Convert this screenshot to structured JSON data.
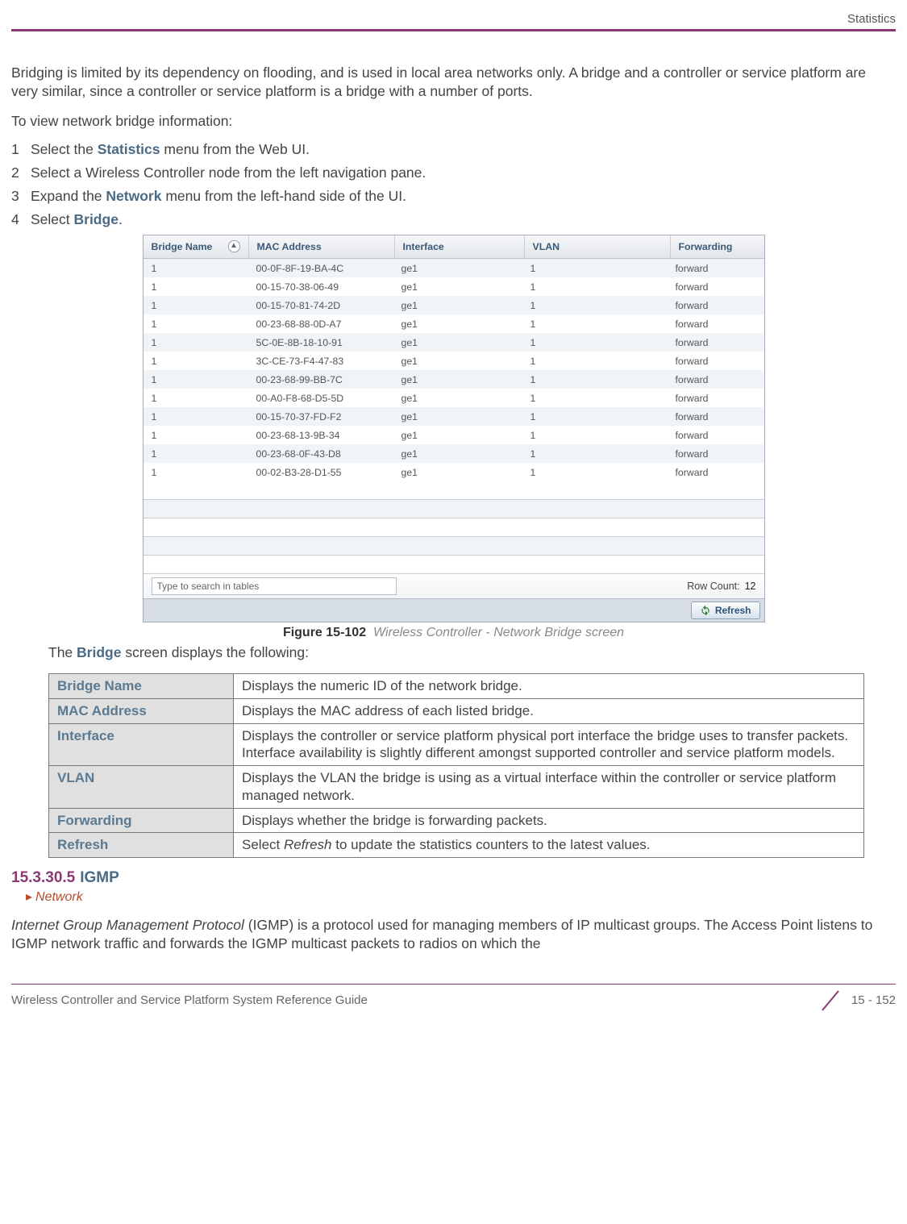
{
  "header": {
    "section": "Statistics"
  },
  "intro": {
    "p1": "Bridging is limited by its dependency on flooding, and is used in local area networks only. A bridge and a controller or service platform are very similar, since a controller or service platform is a bridge with a number of ports.",
    "p2": "To view network bridge information:"
  },
  "steps": [
    {
      "n": "1",
      "pre": "Select the ",
      "bold": "Statistics",
      "post": " menu from the Web UI."
    },
    {
      "n": "2",
      "pre": "Select a Wireless Controller node from the left navigation pane.",
      "bold": "",
      "post": ""
    },
    {
      "n": "3",
      "pre": "Expand the ",
      "bold": "Network",
      "post": " menu from the left-hand side of the UI."
    },
    {
      "n": "4",
      "pre": "Select ",
      "bold": "Bridge",
      "post": "."
    }
  ],
  "screenshot": {
    "headers": {
      "bridge": "Bridge Name",
      "mac": "MAC Address",
      "intf": "Interface",
      "vlan": "VLAN",
      "fwd": "Forwarding"
    },
    "rows": [
      {
        "b": "1",
        "m": "00-0F-8F-19-BA-4C",
        "i": "ge1",
        "v": "1",
        "f": "forward"
      },
      {
        "b": "1",
        "m": "00-15-70-38-06-49",
        "i": "ge1",
        "v": "1",
        "f": "forward"
      },
      {
        "b": "1",
        "m": "00-15-70-81-74-2D",
        "i": "ge1",
        "v": "1",
        "f": "forward"
      },
      {
        "b": "1",
        "m": "00-23-68-88-0D-A7",
        "i": "ge1",
        "v": "1",
        "f": "forward"
      },
      {
        "b": "1",
        "m": "5C-0E-8B-18-10-91",
        "i": "ge1",
        "v": "1",
        "f": "forward"
      },
      {
        "b": "1",
        "m": "3C-CE-73-F4-47-83",
        "i": "ge1",
        "v": "1",
        "f": "forward"
      },
      {
        "b": "1",
        "m": "00-23-68-99-BB-7C",
        "i": "ge1",
        "v": "1",
        "f": "forward"
      },
      {
        "b": "1",
        "m": "00-A0-F8-68-D5-5D",
        "i": "ge1",
        "v": "1",
        "f": "forward"
      },
      {
        "b": "1",
        "m": "00-15-70-37-FD-F2",
        "i": "ge1",
        "v": "1",
        "f": "forward"
      },
      {
        "b": "1",
        "m": "00-23-68-13-9B-34",
        "i": "ge1",
        "v": "1",
        "f": "forward"
      },
      {
        "b": "1",
        "m": "00-23-68-0F-43-D8",
        "i": "ge1",
        "v": "1",
        "f": "forward"
      },
      {
        "b": "1",
        "m": "00-02-B3-28-D1-55",
        "i": "ge1",
        "v": "1",
        "f": "forward"
      }
    ],
    "search_placeholder": "Type to search in tables",
    "rowcount_label": "Row Count:",
    "rowcount_value": "12",
    "refresh": "Refresh"
  },
  "figure": {
    "num": "Figure 15-102",
    "title": "Wireless Controller - Network Bridge screen"
  },
  "desc_intro_pre": "The ",
  "desc_intro_bold": "Bridge",
  "desc_intro_post": " screen displays the following:",
  "desc_rows": [
    {
      "k": "Bridge Name",
      "v": "Displays the numeric ID of the network bridge."
    },
    {
      "k": "MAC Address",
      "v": "Displays the MAC address of each listed bridge."
    },
    {
      "k": "Interface",
      "v": "Displays the controller or service platform physical port interface the bridge uses to transfer packets. Interface availability is slightly different amongst supported controller and service platform models."
    },
    {
      "k": "VLAN",
      "v": "Displays the VLAN the bridge is using as a virtual interface within the controller or service platform managed network."
    },
    {
      "k": "Forwarding",
      "v": "Displays whether the bridge is forwarding packets."
    },
    {
      "k": "Refresh",
      "v_pre": "Select ",
      "v_it": "Refresh",
      "v_post": " to update the statistics counters to the latest values."
    }
  ],
  "section": {
    "num": "15.3.30.5",
    "title": "IGMP",
    "crumb": "Network"
  },
  "igmp_p_pre": "Internet Group Management Protocol",
  "igmp_p_post": " (IGMP) is a protocol used for managing members of IP multicast groups. The Access Point listens to IGMP network traffic and forwards the IGMP multicast packets to radios on which the",
  "footer": {
    "title": "Wireless Controller and Service Platform System Reference Guide",
    "page": "15 - 152"
  }
}
